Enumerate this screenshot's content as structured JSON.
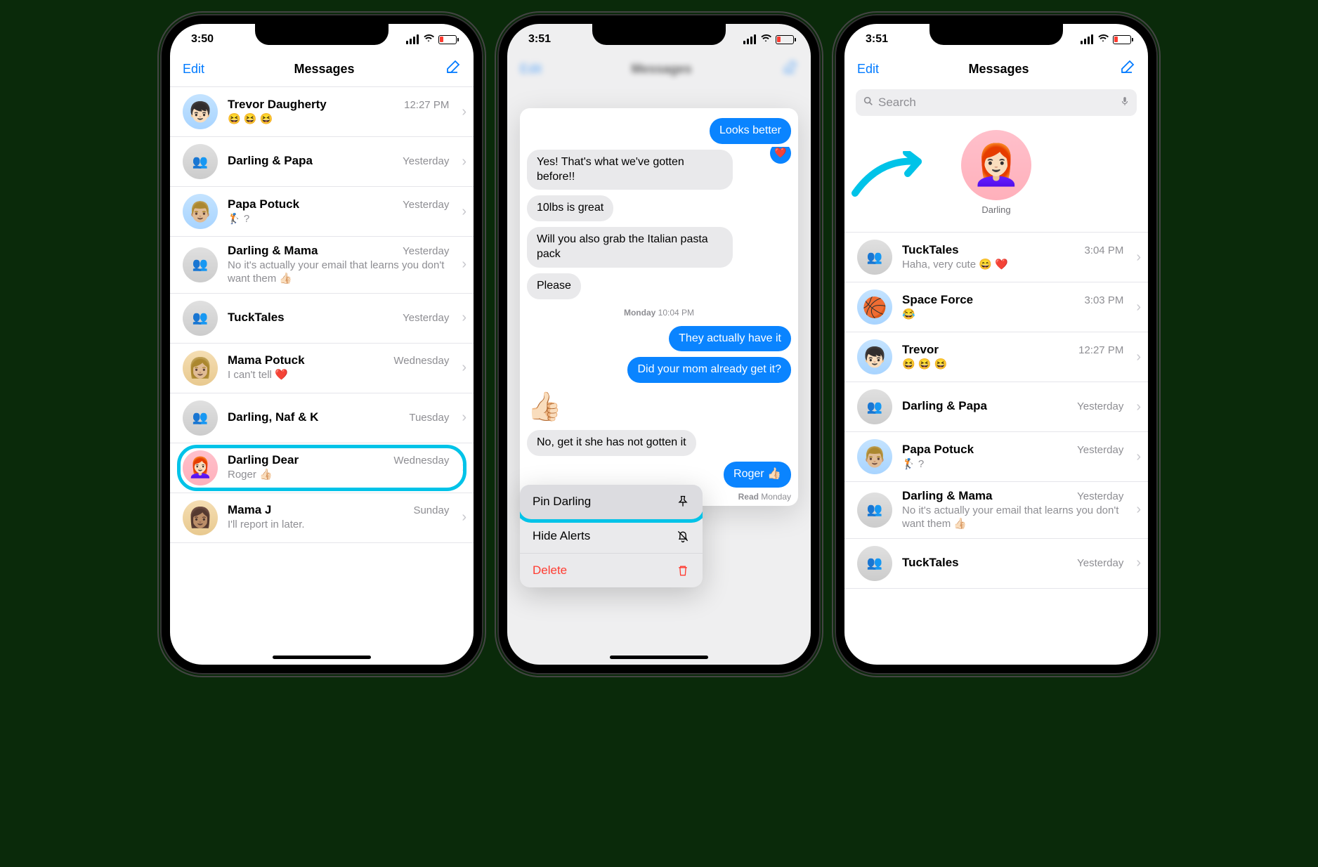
{
  "screen1": {
    "time": "3:50",
    "nav": {
      "edit": "Edit",
      "title": "Messages"
    },
    "rows": [
      {
        "name": "Trevor Daugherty",
        "time": "12:27 PM",
        "preview": "😆 😆 😆",
        "avatar": "blue",
        "face": "👦🏻"
      },
      {
        "name": "Darling & Papa",
        "time": "Yesterday",
        "preview": " ",
        "avatar": "gray",
        "face": "👥",
        "group": true
      },
      {
        "name": "Papa Potuck",
        "time": "Yesterday",
        "preview": "🏌️ ?",
        "avatar": "blue",
        "face": "👨🏼"
      },
      {
        "name": "Darling & Mama",
        "time": "Yesterday",
        "preview": "No it's actually your email that learns you don't want them 👍🏻",
        "avatar": "gray",
        "face": "👥",
        "group": true
      },
      {
        "name": "TuckTales",
        "time": "Yesterday",
        "preview": " ",
        "avatar": "gray",
        "face": "👥",
        "group": true
      },
      {
        "name": "Mama Potuck",
        "time": "Wednesday",
        "preview": "I can't tell ❤️",
        "avatar": "tan",
        "face": "👩🏼"
      },
      {
        "name": "Darling, Naf & K",
        "time": "Tuesday",
        "preview": " ",
        "avatar": "gray",
        "face": "👥",
        "group": true
      },
      {
        "name": "Darling Dear",
        "time": "Wednesday",
        "preview": "Roger 👍🏻",
        "avatar": "pink",
        "face": "👩🏻‍🦰",
        "highlight": true
      },
      {
        "name": "Mama J",
        "time": "Sunday",
        "preview": "I'll report in later.",
        "avatar": "tan",
        "face": "👩🏽"
      }
    ]
  },
  "screen2": {
    "time": "3:51",
    "preview": {
      "out_top": "Looks better",
      "in1": "Yes! That's what we've gotten before!!",
      "in2": "10lbs is great",
      "in3": "Will you also grab the Italian pasta pack",
      "in4": "Please",
      "time_div": "Monday 10:04 PM",
      "out2": "They actually have it",
      "out3": "Did your mom already get it?",
      "emoji": "👍🏻",
      "in5": "No, get it she has not gotten it",
      "out4": "Roger 👍🏻",
      "read": "Read Monday"
    },
    "menu": {
      "pin": "Pin Darling",
      "hide": "Hide Alerts",
      "delete": "Delete"
    }
  },
  "screen3": {
    "time": "3:51",
    "nav": {
      "edit": "Edit",
      "title": "Messages"
    },
    "search_placeholder": "Search",
    "pinned": {
      "label": "Darling"
    },
    "rows": [
      {
        "name": "TuckTales",
        "time": "3:04 PM",
        "preview": "Haha, very cute 😄 ❤️",
        "avatar": "gray",
        "face": "👥",
        "group": true
      },
      {
        "name": "Space Force",
        "time": "3:03 PM",
        "preview": "😂",
        "avatar": "blue",
        "face": "🏀"
      },
      {
        "name": "Trevor",
        "time": "12:27 PM",
        "preview": "😆 😆 😆",
        "avatar": "blue",
        "face": "👦🏻"
      },
      {
        "name": "Darling & Papa",
        "time": "Yesterday",
        "preview": " ",
        "avatar": "gray",
        "face": "👥",
        "group": true
      },
      {
        "name": "Papa Potuck",
        "time": "Yesterday",
        "preview": "🏌️ ?",
        "avatar": "blue",
        "face": "👨🏼"
      },
      {
        "name": "Darling & Mama",
        "time": "Yesterday",
        "preview": "No it's actually your email that learns you don't want them 👍🏻",
        "avatar": "gray",
        "face": "👥",
        "group": true
      },
      {
        "name": "TuckTales",
        "time": "Yesterday",
        "preview": " ",
        "avatar": "gray",
        "face": "👥",
        "group": true
      }
    ]
  }
}
